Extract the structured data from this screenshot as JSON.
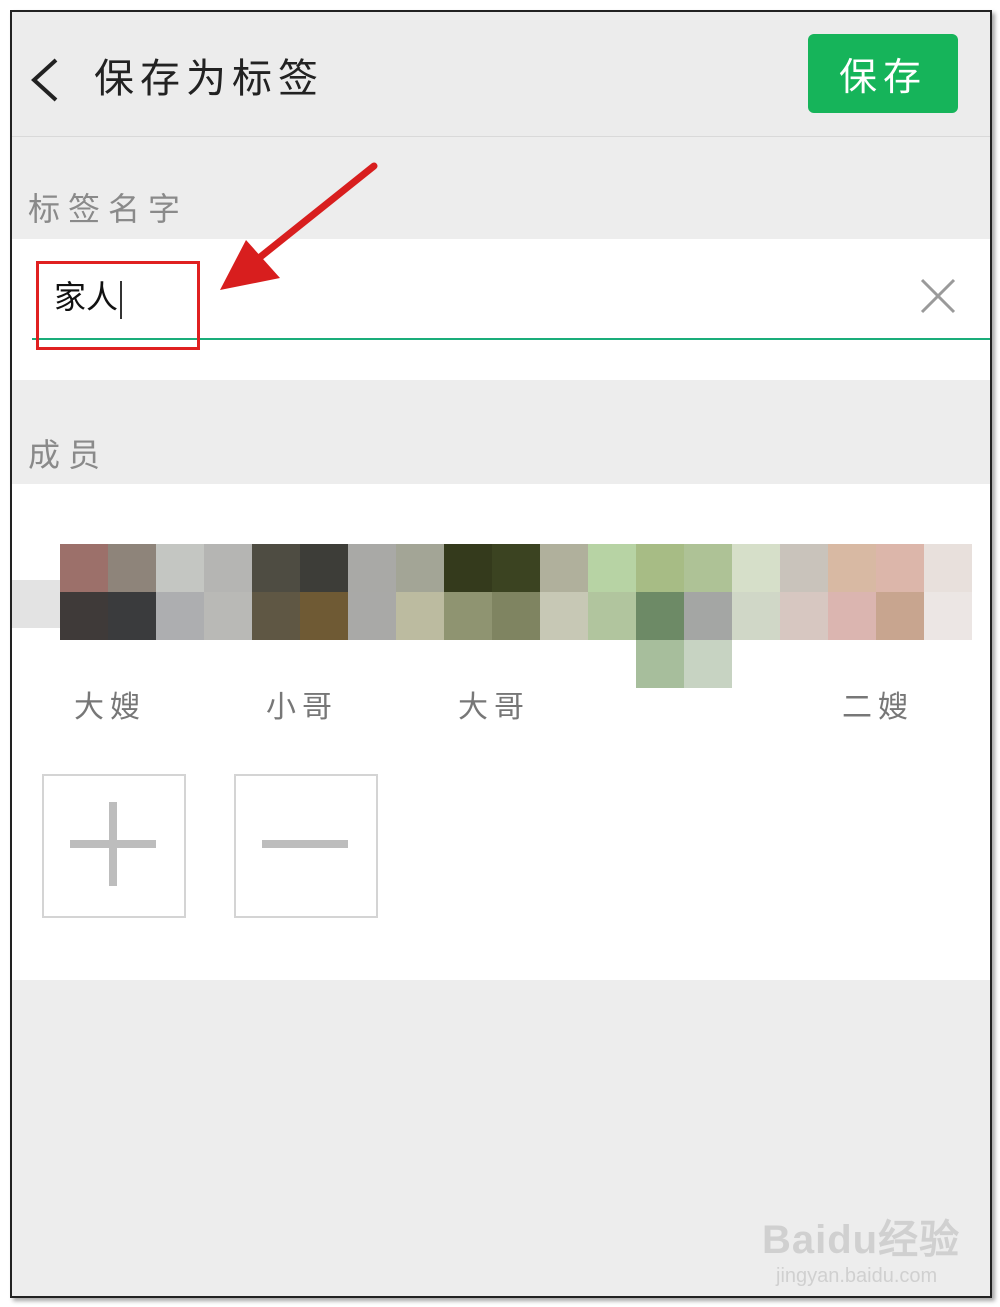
{
  "header": {
    "title": "保存为标签",
    "save_label": "保存"
  },
  "tag_name": {
    "section_label": "标签名字",
    "value": "家人"
  },
  "members": {
    "section_label": "成员",
    "items": [
      {
        "name": "大嫂"
      },
      {
        "name": "小哥"
      },
      {
        "name": "大哥"
      },
      {
        "name": ""
      },
      {
        "name": "二嫂"
      }
    ]
  },
  "icons": {
    "back": "chevron-left-icon",
    "clear": "close-icon",
    "add": "plus-icon",
    "remove": "minus-icon"
  },
  "colors": {
    "accent": "#16b45a",
    "highlight": "#e02020",
    "input_underline": "#1aad7a"
  },
  "watermark": {
    "main": "Baidu经验",
    "sub": "jingyan.baidu.com"
  }
}
